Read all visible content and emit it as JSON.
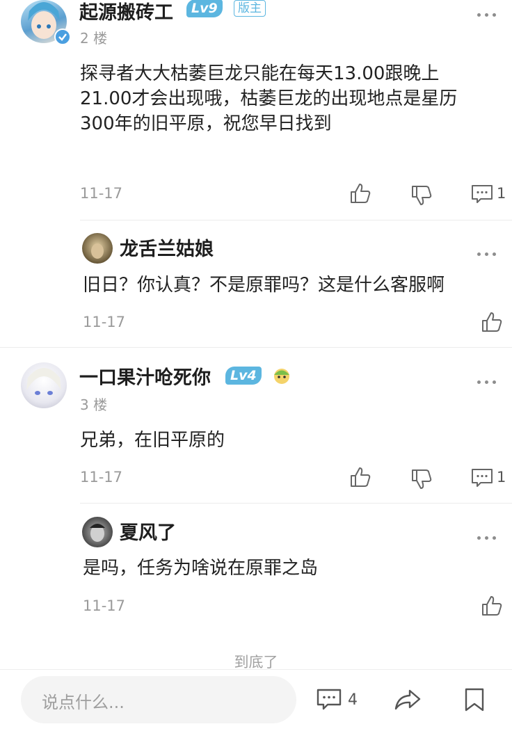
{
  "comments": [
    {
      "name": "起源搬砖工",
      "level": "Lv9",
      "tag": "版主",
      "floor": "2 楼",
      "text_lines": [
        "探寻者大大枯萎巨龙只能在每天13.00跟晚上",
        "21.00才会出现哦，枯萎巨龙的出现地点是星历",
        "300年的旧平原，祝您早日找到"
      ],
      "date": "11-17",
      "reply_count": "1",
      "reply": {
        "name": "龙舌兰姑娘",
        "text": "旧日？你认真？不是原罪吗？这是什么客服啊",
        "date": "11-17"
      }
    },
    {
      "name": "一口果汁呛死你",
      "level": "Lv4",
      "floor": "3 楼",
      "text": "兄弟，在旧平原的",
      "date": "11-17",
      "reply_count": "1",
      "reply": {
        "name": "夏风了",
        "text": "是吗，任务为啥说在原罪之岛",
        "date": "11-17"
      }
    }
  ],
  "end_text": "到底了",
  "bottom_bar": {
    "placeholder": "说点什么...",
    "comment_count": "4"
  },
  "colors": {
    "accent": "#5cb6e0",
    "secondary_text": "#9a9a9a"
  }
}
